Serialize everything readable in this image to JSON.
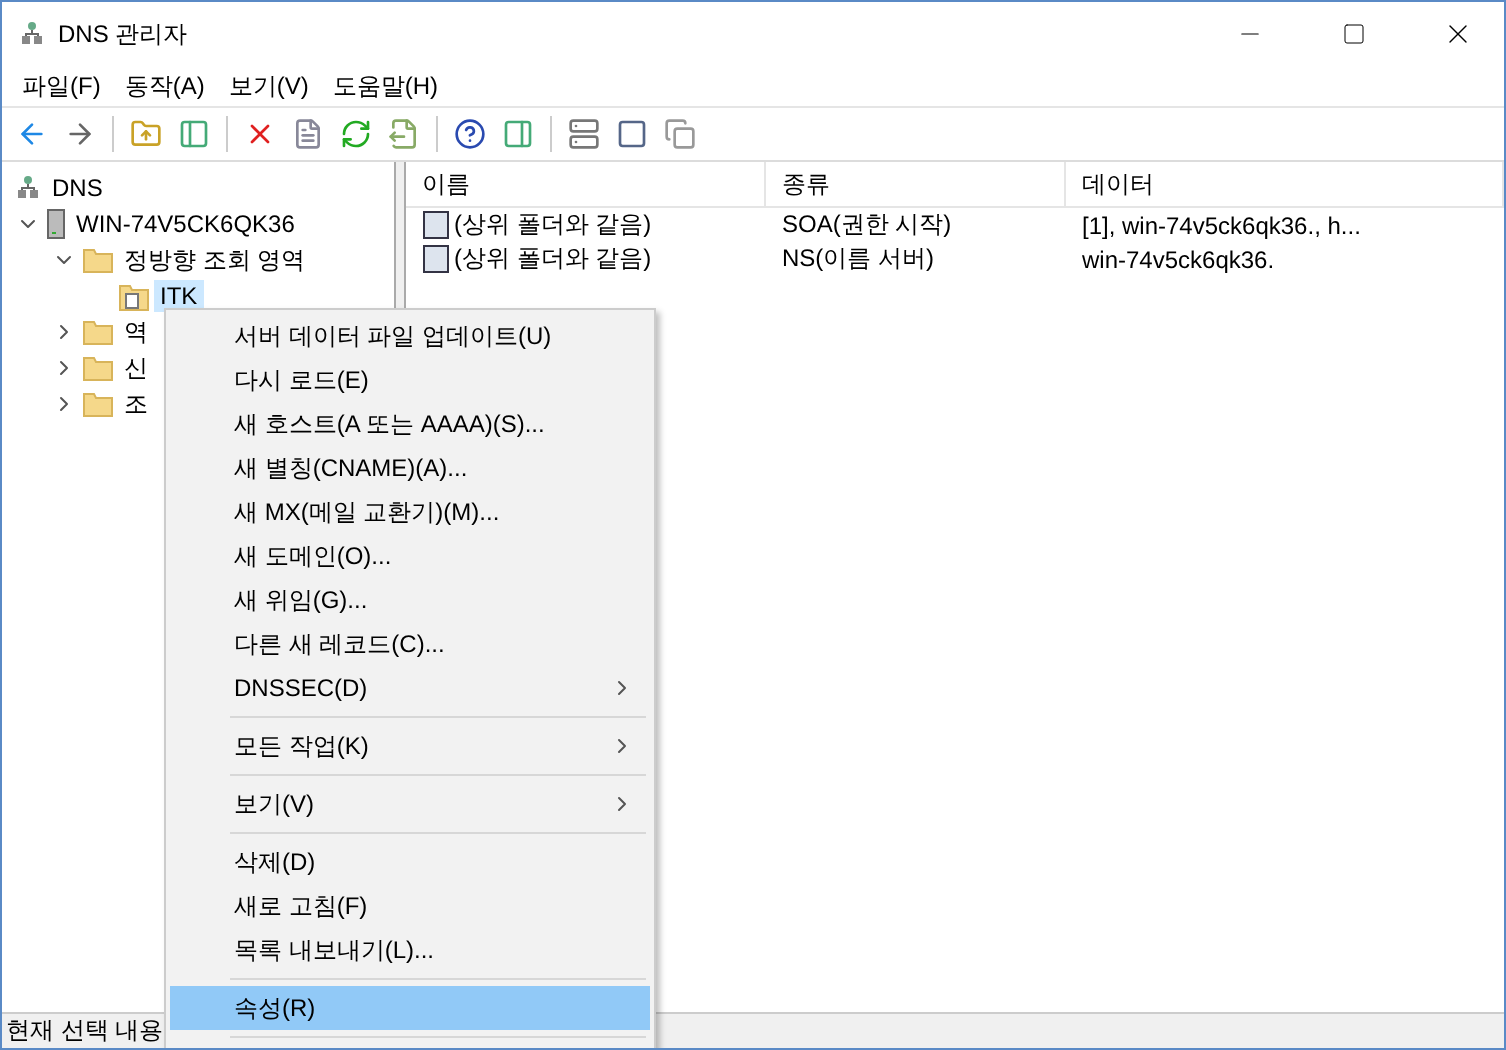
{
  "window": {
    "title": "DNS 관리자"
  },
  "menu_bar": [
    "파일(F)",
    "동작(A)",
    "보기(V)",
    "도움말(H)"
  ],
  "tree": [
    {
      "label": "DNS",
      "kind": "dns",
      "selected": false,
      "children": [
        {
          "label": "WIN-74V5CK6QK36",
          "kind": "server",
          "selected": false,
          "expanded": true,
          "children": [
            {
              "label": "정방향 조회 영역",
              "kind": "folder",
              "selected": false,
              "expanded": true,
              "children": [
                {
                  "label": "ITK",
                  "kind": "zone",
                  "selected": true
                }
              ]
            },
            {
              "label": "역",
              "kind": "folder",
              "selected": false,
              "expanded": false
            },
            {
              "label": "신",
              "kind": "folder",
              "selected": false,
              "expanded": false
            },
            {
              "label": "조",
              "kind": "folder",
              "selected": false,
              "expanded": false
            }
          ]
        }
      ]
    }
  ],
  "list": {
    "columns": [
      "이름",
      "종류",
      "데이터"
    ],
    "rows": [
      {
        "name": "(상위 폴더와 같음)",
        "type": "SOA(권한 시작)",
        "data": "[1], win-74v5ck6qk36., h..."
      },
      {
        "name": "(상위 폴더와 같음)",
        "type": "NS(이름 서버)",
        "data": "win-74v5ck6qk36."
      }
    ]
  },
  "context_menu": [
    {
      "kind": "item",
      "label": "서버 데이터 파일 업데이트(U)",
      "selected": false
    },
    {
      "kind": "item",
      "label": "다시 로드(E)",
      "selected": false
    },
    {
      "kind": "item",
      "label": "새 호스트(A 또는 AAAA)(S)...",
      "selected": false
    },
    {
      "kind": "item",
      "label": "새 별칭(CNAME)(A)...",
      "selected": false
    },
    {
      "kind": "item",
      "label": "새 MX(메일 교환기)(M)...",
      "selected": false
    },
    {
      "kind": "item",
      "label": "새 도메인(O)...",
      "selected": false
    },
    {
      "kind": "item",
      "label": "새 위임(G)...",
      "selected": false
    },
    {
      "kind": "item",
      "label": "다른 새 레코드(C)...",
      "selected": false
    },
    {
      "kind": "submenu",
      "label": "DNSSEC(D)",
      "selected": false
    },
    {
      "kind": "separator"
    },
    {
      "kind": "submenu",
      "label": "모든 작업(K)",
      "selected": false
    },
    {
      "kind": "separator"
    },
    {
      "kind": "submenu",
      "label": "보기(V)",
      "selected": false
    },
    {
      "kind": "separator"
    },
    {
      "kind": "item",
      "label": "삭제(D)",
      "selected": false
    },
    {
      "kind": "item",
      "label": "새로 고침(F)",
      "selected": false
    },
    {
      "kind": "item",
      "label": "목록 내보내기(L)...",
      "selected": false
    },
    {
      "kind": "separator"
    },
    {
      "kind": "item",
      "label": "속성(R)",
      "selected": true
    },
    {
      "kind": "separator"
    }
  ],
  "status_bar": "현재 선택 내용"
}
